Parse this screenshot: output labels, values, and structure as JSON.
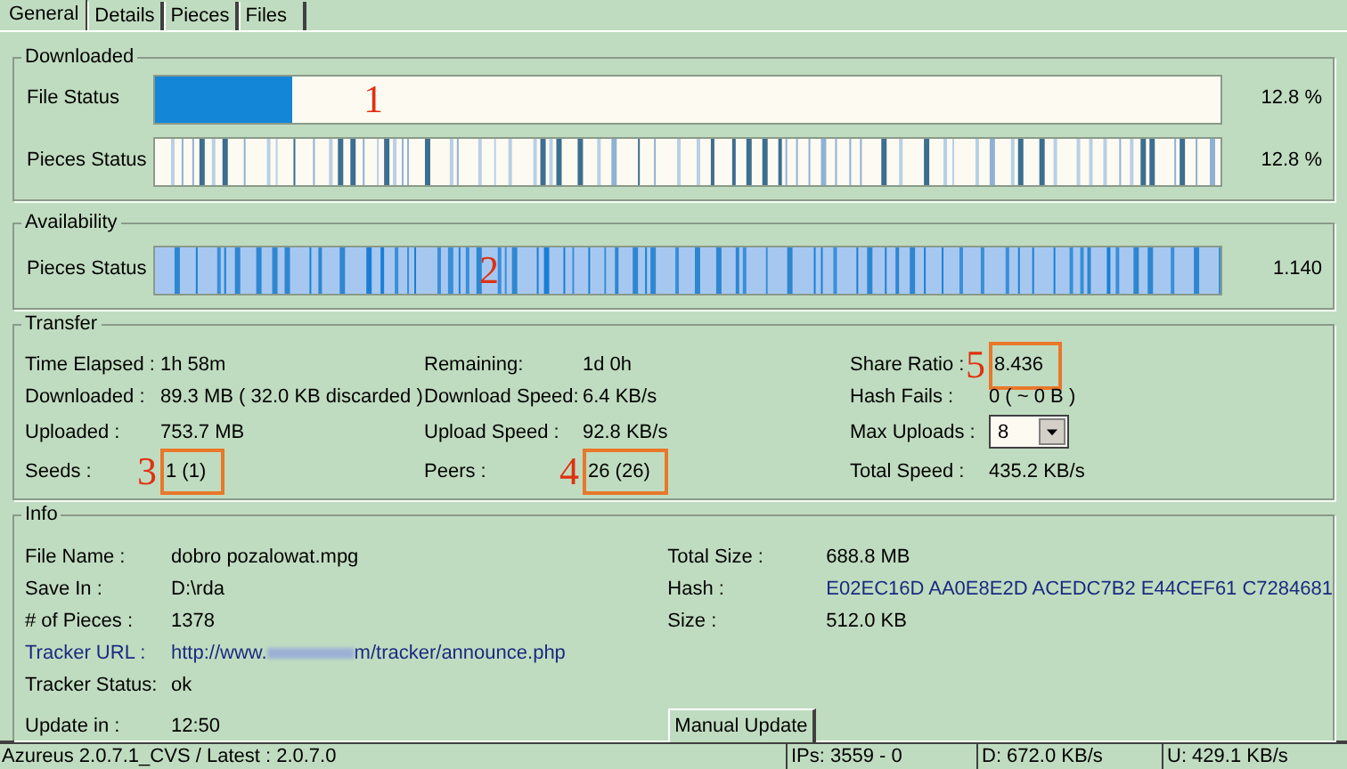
{
  "tabs": [
    {
      "label": "General",
      "selected": true
    },
    {
      "label": "Details",
      "selected": false
    },
    {
      "label": "Pieces",
      "selected": false
    },
    {
      "label": "Files",
      "selected": false
    }
  ],
  "downloaded": {
    "title": "Downloaded",
    "rows": [
      {
        "kind": "progress",
        "label": "File Status",
        "level": 0.128,
        "reading": "12.8 %",
        "marker": "1"
      },
      {
        "kind": "pieces",
        "label": "Pieces Status",
        "reading": "12.8 %"
      }
    ]
  },
  "availability": {
    "title": "Availability",
    "rows": [
      {
        "kind": "availability",
        "label": "Pieces Status",
        "reading": "1.140",
        "marker": "2"
      }
    ]
  },
  "transfer": {
    "title": "Transfer",
    "columns": [
      [
        {
          "label": "Time Elapsed :",
          "value": "1h 58m"
        },
        {
          "label": "Downloaded :",
          "value": "89.3 MB ( 32.0 KB discarded )"
        },
        {
          "label": "Uploaded :",
          "value": "753.7 MB"
        },
        {
          "label": "Seeds :",
          "value": "1 (1)",
          "marker": "3",
          "boxed": true
        }
      ],
      [
        {
          "label": "Remaining:",
          "value": "1d 0h"
        },
        {
          "label": "Download Speed:",
          "value": "6.4 KB/s"
        },
        {
          "label": "Upload Speed :",
          "value": "92.8 KB/s"
        },
        {
          "label": "Peers :",
          "value": "26 (26)",
          "marker": "4",
          "boxed": true
        }
      ],
      [
        {
          "label": "Share Ratio :",
          "value": "8.436",
          "marker": "5",
          "boxed": true
        },
        {
          "label": "Hash Fails :",
          "value": "0 ( ~ 0 B )"
        },
        {
          "label": "Max Uploads :",
          "value": "8",
          "kind": "dropdown"
        },
        {
          "label": "Total Speed :",
          "value": "435.2 KB/s"
        }
      ]
    ]
  },
  "info": {
    "title": "Info",
    "left": [
      {
        "label": "File Name :",
        "value": "dobro pozalowat.mpg"
      },
      {
        "label": "Save In :",
        "value": "D:\\rda"
      },
      {
        "label": "# of Pieces :",
        "value": "1378"
      },
      {
        "label": "Tracker URL :",
        "kind": "link",
        "value_start": "http://www.",
        "value_end": "m/tracker/announce.php"
      },
      {
        "label": "Tracker Status:",
        "value": "ok"
      },
      {
        "label": "Update in :",
        "value": "12:50"
      }
    ],
    "right": [
      {
        "label": "Total Size :",
        "value": "688.8 MB"
      },
      {
        "label": "Hash :",
        "value": "E02EC16D AA0E8E2D ACEDC7B2 E44CEF61 C7284681",
        "kind": "link"
      },
      {
        "label": "Size :",
        "value": "512.0 KB"
      }
    ],
    "button": "Manual Update"
  },
  "status_bar": [
    "Azureus 2.0.7.1_CVS / Latest : 2.0.7.0",
    "IPs: 3559 - 0",
    "D: 672.0 KB/s",
    "U: 429.1 KB/s"
  ]
}
